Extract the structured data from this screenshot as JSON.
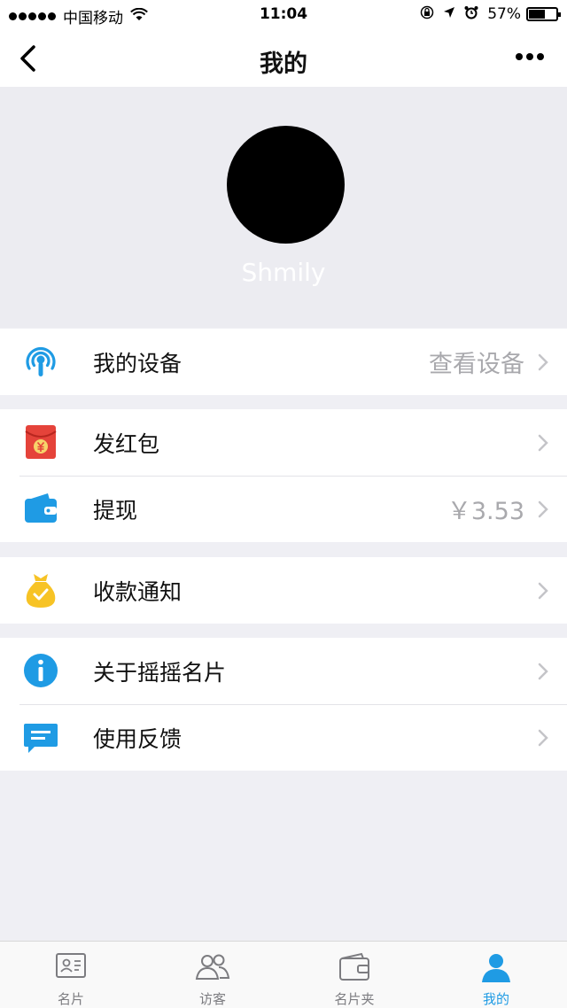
{
  "status_bar": {
    "carrier": "中国移动",
    "time": "11:04",
    "battery": "57%"
  },
  "nav": {
    "title": "我的"
  },
  "profile": {
    "name": "Shmily"
  },
  "menu": {
    "groups": [
      {
        "items": [
          {
            "label": "我的设备",
            "value": "查看设备",
            "icon": "broadcast-icon"
          }
        ]
      },
      {
        "items": [
          {
            "label": "发红包",
            "value": "",
            "icon": "red-envelope-icon"
          },
          {
            "label": "提现",
            "value": "￥3.53",
            "icon": "wallet-icon"
          }
        ]
      },
      {
        "items": [
          {
            "label": "收款通知",
            "value": "",
            "icon": "money-bag-icon"
          }
        ]
      },
      {
        "items": [
          {
            "label": "关于摇摇名片",
            "value": "",
            "icon": "info-icon"
          },
          {
            "label": "使用反馈",
            "value": "",
            "icon": "feedback-icon"
          }
        ]
      }
    ]
  },
  "tabs": [
    {
      "label": "名片",
      "icon": "card-icon",
      "active": false
    },
    {
      "label": "访客",
      "icon": "visitors-icon",
      "active": false
    },
    {
      "label": "名片夹",
      "icon": "card-holder-icon",
      "active": false
    },
    {
      "label": "我的",
      "icon": "user-icon",
      "active": true
    }
  ],
  "colors": {
    "accent": "#1f9be4",
    "background": "#efeff4",
    "red_envelope": "#e5433a",
    "money_bag": "#f7c325"
  }
}
